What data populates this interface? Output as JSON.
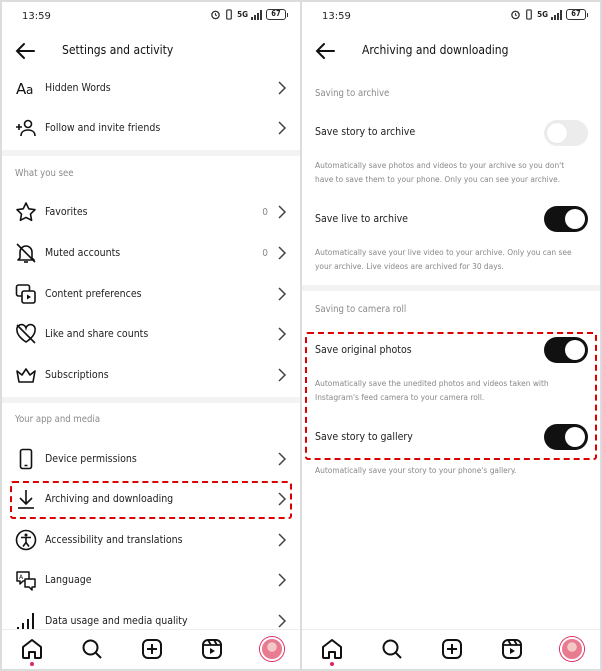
{
  "status_bar": {
    "time": "13:59",
    "network": "5G",
    "battery": "67"
  },
  "left": {
    "title": "Settings and activity",
    "items_top": [
      {
        "icon": "text-aa-icon",
        "label": "Hidden Words"
      },
      {
        "icon": "add-person-icon",
        "label": "Follow and invite friends"
      }
    ],
    "section_what_you_see": "What you see",
    "items_what_you_see": [
      {
        "icon": "star-icon",
        "label": "Favorites",
        "count": "0"
      },
      {
        "icon": "muted-bell-icon",
        "label": "Muted accounts",
        "count": "0"
      },
      {
        "icon": "media-icon",
        "label": "Content preferences"
      },
      {
        "icon": "heart-off-icon",
        "label": "Like and share counts"
      },
      {
        "icon": "crown-icon",
        "label": "Subscriptions"
      }
    ],
    "section_app_media": "Your app and media",
    "items_app_media": [
      {
        "icon": "phone-icon",
        "label": "Device permissions"
      },
      {
        "icon": "download-icon",
        "label": "Archiving and downloading"
      },
      {
        "icon": "accessibility-icon",
        "label": "Accessibility and translations"
      },
      {
        "icon": "language-icon",
        "label": "Language"
      },
      {
        "icon": "signal-icon",
        "label": "Data usage and media quality"
      }
    ]
  },
  "right": {
    "title": "Archiving and downloading",
    "section_archive": "Saving to archive",
    "save_story_archive": {
      "label": "Save story to archive",
      "enabled": false,
      "desc": "Automatically save photos and videos to your archive so you don't have to save them to your phone. Only you can see your archive."
    },
    "save_live_archive": {
      "label": "Save live to archive",
      "enabled": true,
      "desc": "Automatically save your live video to your archive. Only you can see your archive. Live videos are archived for 30 days."
    },
    "section_camera_roll": "Saving to camera roll",
    "save_original_photos": {
      "label": "Save original photos",
      "enabled": true,
      "desc": "Automatically save the unedited photos and videos taken with Instagram's feed camera to your camera roll."
    },
    "save_story_gallery": {
      "label": "Save story to gallery",
      "enabled": true,
      "desc": "Automatically save your story to your phone's gallery."
    }
  },
  "bottom_nav": [
    "home-icon",
    "search-icon",
    "create-icon",
    "reels-icon",
    "profile-avatar"
  ],
  "colors": {
    "highlight": "#dd0000",
    "toggle_on": "#111111",
    "toggle_off": "#ececec",
    "nav_dot": "#e0245e"
  }
}
